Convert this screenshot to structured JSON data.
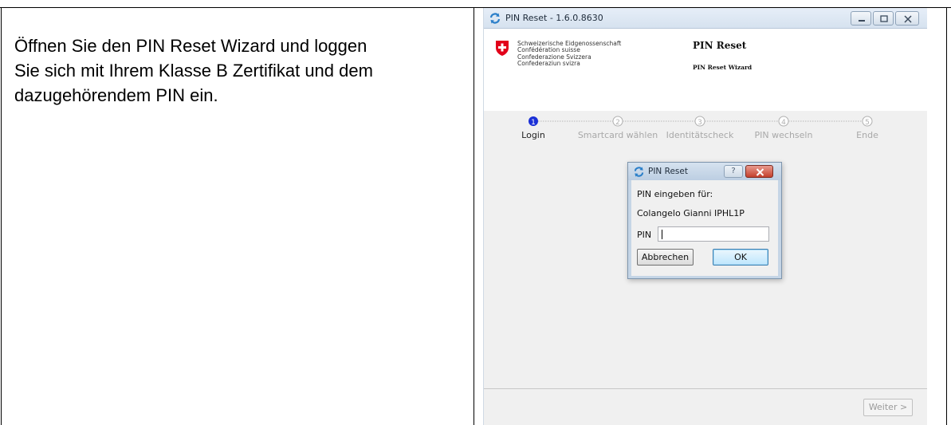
{
  "instruction": {
    "line1": "Öffnen Sie den PIN Reset Wizard und loggen",
    "line2": "Sie sich mit Ihrem Klasse B Zertifikat und dem",
    "line3": "dazugehörendem PIN ein."
  },
  "window": {
    "title": "PIN Reset - 1.6.0.8630",
    "icon": "refresh-icon",
    "controls": [
      "minimize-icon",
      "maximize-icon",
      "close-icon"
    ]
  },
  "header": {
    "federation": [
      "Schweizerische Eidgenossenschaft",
      "Confédération suisse",
      "Confederazione Svizzera",
      "Confederaziun svizra"
    ],
    "title": "PIN Reset",
    "subtitle": "PIN Reset Wizard"
  },
  "steps": [
    {
      "number": "1",
      "label": "Login",
      "active": true
    },
    {
      "number": "2",
      "label": "Smartcard wählen",
      "active": false
    },
    {
      "number": "3",
      "label": "Identitätscheck",
      "active": false
    },
    {
      "number": "4",
      "label": "PIN wechseln",
      "active": false
    },
    {
      "number": "5",
      "label": "Ende",
      "active": false
    }
  ],
  "dialog": {
    "title": "PIN Reset",
    "help": "?",
    "prompt": "PIN eingeben für:",
    "user": "Colangelo Gianni IPHL1P",
    "pin_label": "PIN",
    "pin_value": "",
    "cancel_label": "Abbrechen",
    "ok_label": "OK"
  },
  "footer": {
    "next_label": "Weiter >"
  },
  "colors": {
    "active_step": "#1a2fd6",
    "inactive_step": "#a8a8a8",
    "swiss_red": "#e2001a"
  }
}
